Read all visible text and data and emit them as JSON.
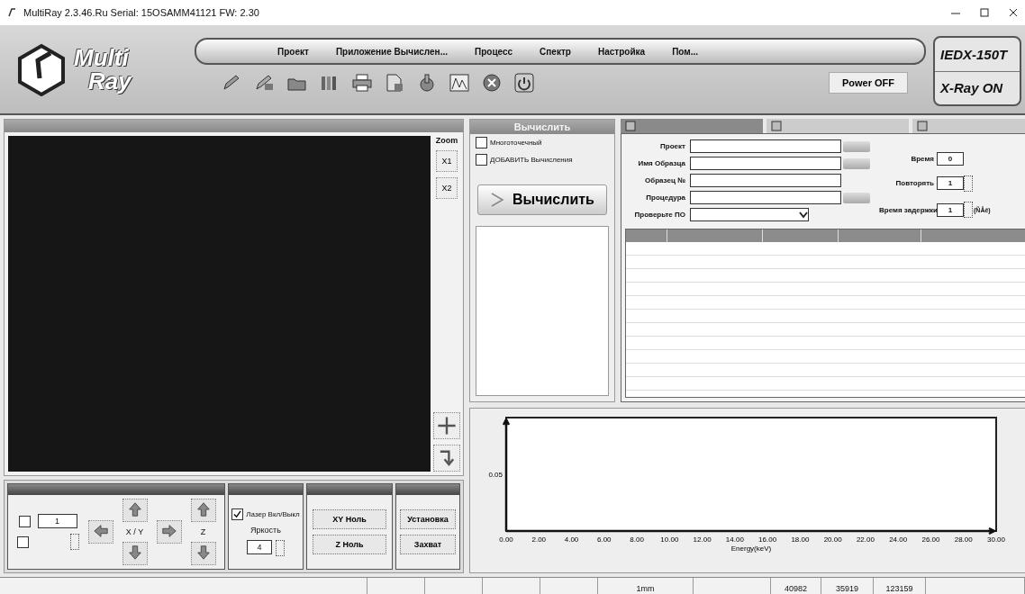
{
  "window": {
    "title": "MultiRay 2.3.46.Ru Serial: 15OSAMM41121 FW: 2.30"
  },
  "logo": {
    "line1": "Multi",
    "line2": "Ray"
  },
  "menu": [
    "Проект",
    "Приложение Вычислен...",
    "Процесс",
    "Спектр",
    "Настройка",
    "Пом..."
  ],
  "power_button": "Power OFF",
  "device": {
    "model": "IEDX-150T",
    "xray_status": "X-Ray ON"
  },
  "camera": {
    "zoom_label": "Zoom",
    "zoom_buttons": [
      "X1",
      "X2"
    ]
  },
  "calculate": {
    "header": "Вычислить",
    "options": [
      {
        "label": "Многоточечный",
        "checked": false
      },
      {
        "label": "ДОБАВИТЬ Вычисления",
        "checked": false
      }
    ],
    "button": "Вычислить"
  },
  "info": {
    "tabs": [
      {
        "selected": true
      },
      {
        "selected": false
      },
      {
        "selected": false
      }
    ],
    "fields": [
      {
        "label": "Проект",
        "kind": "browse"
      },
      {
        "label": "Имя Образца",
        "kind": "browse"
      },
      {
        "label": "Образец №",
        "kind": "plain"
      },
      {
        "label": "Процедура",
        "kind": "browse"
      },
      {
        "label": "Проверьте ПО",
        "kind": "dropdown"
      }
    ],
    "timing": [
      {
        "label": "Время",
        "value": "0",
        "kind": "plain"
      },
      {
        "label": "Повторять",
        "value": "1",
        "kind": "spin"
      },
      {
        "label": "Время задержки",
        "value": "1",
        "kind": "spin",
        "unit": "(ÑÅê)"
      }
    ]
  },
  "motion": {
    "step_value": "1",
    "axis_label": "X / Y",
    "z_label": "Z",
    "options": [
      {
        "checked": false
      },
      {
        "checked": false
      }
    ]
  },
  "laser": {
    "label": "Лазер Вкл/Выкл",
    "checked": true,
    "brightness_label": "Яркость",
    "brightness": "4"
  },
  "zero_buttons": [
    "XY Ноль",
    "Z Ноль"
  ],
  "setup_buttons": [
    "Установка",
    "Захват"
  ],
  "spectrum": {
    "x_axis_title": "Energy(keV)",
    "y_label": "0.05",
    "x_labels": [
      "0.00",
      "2.00",
      "4.00",
      "6.00",
      "8.00",
      "10.00",
      "12.00",
      "14.00",
      "16.00",
      "18.00",
      "20.00",
      "22.00",
      "24.00",
      "26.00",
      "28.00",
      "30.00"
    ]
  },
  "status_bar": [
    "1mm",
    "40982",
    "35919",
    "123159"
  ]
}
